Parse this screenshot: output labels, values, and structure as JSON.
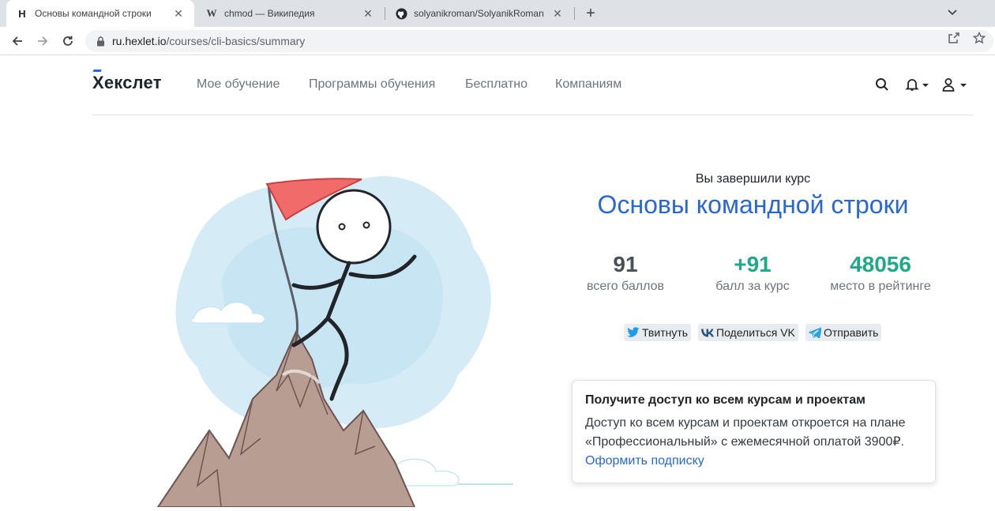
{
  "browser": {
    "tabs": [
      {
        "title": "Основы командной строки",
        "favicon": "hexlet-favicon",
        "active": true
      },
      {
        "title": "chmod — Википедия",
        "favicon": "wikipedia-favicon",
        "active": false
      },
      {
        "title": "solyanikroman/SolyanikRoman",
        "favicon": "github-favicon",
        "active": false
      }
    ],
    "url_host": "ru.hexlet.io",
    "url_path": "/courses/cli-basics/summary"
  },
  "header": {
    "logo": "Хекслет",
    "nav": [
      "Мое обучение",
      "Программы обучения",
      "Бесплатно",
      "Компаниям"
    ]
  },
  "summary": {
    "completed_label": "Вы завершили курс",
    "course_title": "Основы командной строки",
    "stats": [
      {
        "value": "91",
        "label": "всего баллов",
        "color": "#495057"
      },
      {
        "value": "+91",
        "label": "балл за курс",
        "color": "#20a88a"
      },
      {
        "value": "48056",
        "label": "место в рейтинге",
        "color": "#20a88a"
      }
    ],
    "share": {
      "twitter": "Твитнуть",
      "vk": "Поделиться VK",
      "telegram": "Отправить"
    }
  },
  "promo": {
    "title": "Получите доступ ко всем курсам и проектам",
    "text": "Доступ ко всем курсам и проектам откроется на плане «Профессиональный» с ежемесячной оплатой 3900₽.",
    "link": "Оформить подписку"
  },
  "colors": {
    "accent": "#2768d2",
    "success": "#20a88a"
  }
}
